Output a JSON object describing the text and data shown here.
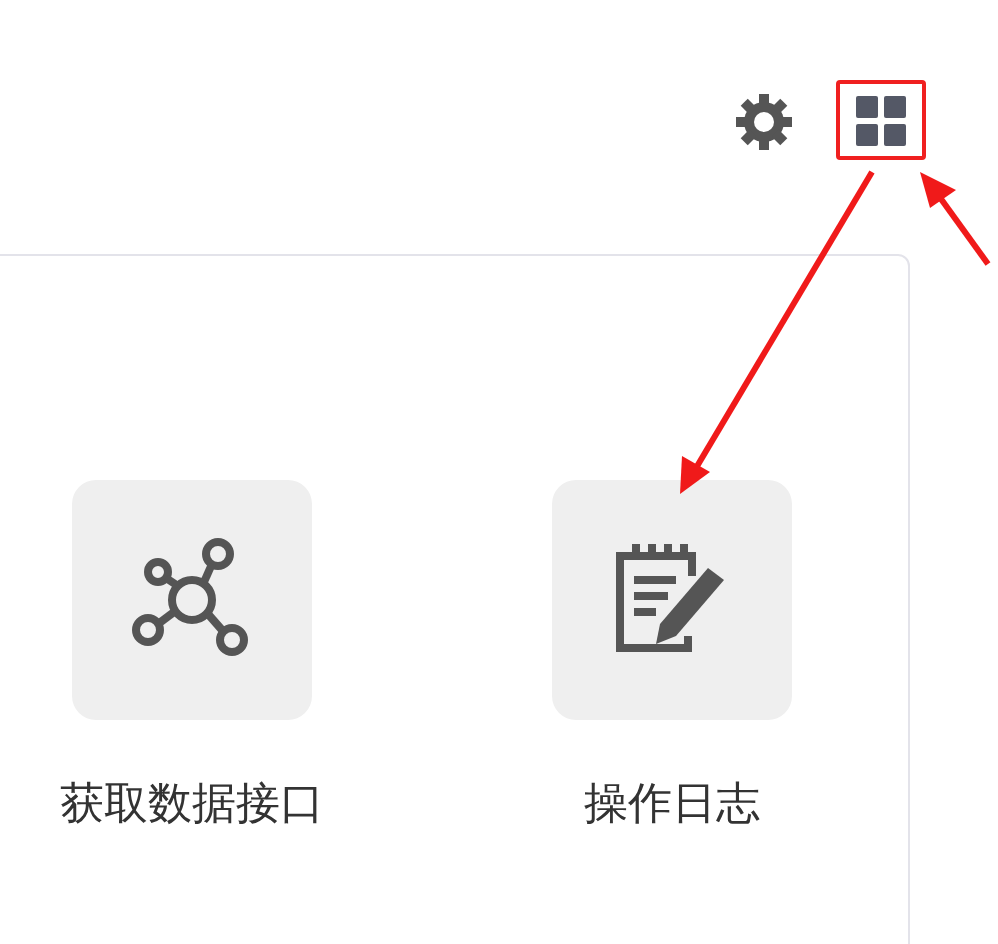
{
  "toolbar": {
    "apps_button": {
      "highlighted": true
    }
  },
  "apps": [
    {
      "label": "获取数据接口",
      "kind": "network"
    },
    {
      "label": "操作日志",
      "kind": "log"
    }
  ]
}
